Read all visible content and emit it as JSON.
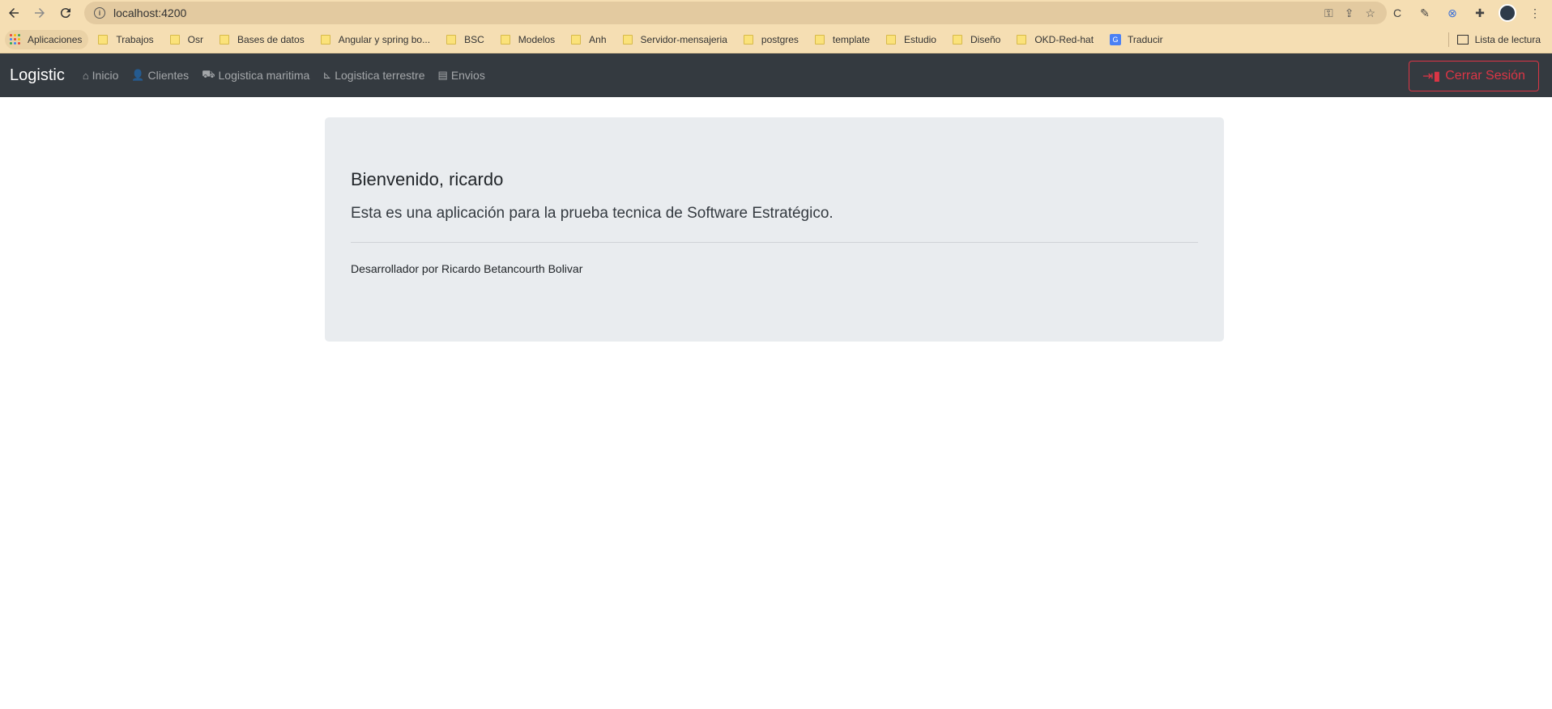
{
  "browser": {
    "url": "localhost:4200",
    "bookmarks": [
      {
        "label": "Aplicaciones",
        "type": "apps"
      },
      {
        "label": "Trabajos",
        "type": "folder"
      },
      {
        "label": "Osr",
        "type": "folder"
      },
      {
        "label": "Bases de datos",
        "type": "folder"
      },
      {
        "label": "Angular y spring bo...",
        "type": "folder"
      },
      {
        "label": "BSC",
        "type": "folder"
      },
      {
        "label": "Modelos",
        "type": "folder"
      },
      {
        "label": "Anh",
        "type": "folder"
      },
      {
        "label": "Servidor-mensajeria",
        "type": "folder"
      },
      {
        "label": "postgres",
        "type": "folder"
      },
      {
        "label": "template",
        "type": "folder"
      },
      {
        "label": "Estudio",
        "type": "folder"
      },
      {
        "label": "Diseño",
        "type": "folder"
      },
      {
        "label": "OKD-Red-hat",
        "type": "folder"
      },
      {
        "label": "Traducir",
        "type": "translate"
      }
    ],
    "reading_list": "Lista de lectura"
  },
  "navbar": {
    "brand": "Logistic",
    "links": [
      {
        "label": "Inicio",
        "icon": "home-icon"
      },
      {
        "label": "Clientes",
        "icon": "user-plus-icon"
      },
      {
        "label": "Logistica maritima",
        "icon": "truck-icon"
      },
      {
        "label": "Logistica terrestre",
        "icon": "dolly-icon"
      },
      {
        "label": "Envios",
        "icon": "clipboard-icon"
      }
    ],
    "logout_label": "Cerrar Sesión"
  },
  "main": {
    "title": "Bienvenido, ricardo",
    "lead": "Esta es una aplicación para la prueba tecnica de Software Estratégico.",
    "credit": "Desarrollador por Ricardo Betancourth Bolivar"
  },
  "colors": {
    "chrome_bg": "#f5deb3",
    "navbar_bg": "#343a40",
    "danger": "#dc3545",
    "jumbotron_bg": "#e9ecef"
  }
}
